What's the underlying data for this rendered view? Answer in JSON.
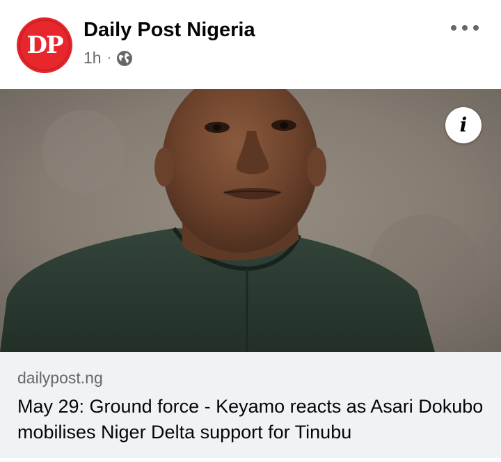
{
  "post": {
    "page_name": "Daily Post Nigeria",
    "avatar_text": "DP",
    "time": "1h",
    "separator": "·",
    "audience_icon": "globe-icon",
    "more_icon": "more-horizontal-icon",
    "info_icon": "info-icon",
    "info_glyph": "i",
    "link": {
      "domain": "dailypost.ng",
      "headline": "May 29: Ground force - Keyamo reacts as Asari Dokubo mobilises Niger Delta support for Tinubu"
    }
  },
  "colors": {
    "brand_red": "#e5262c",
    "name_text": "#050505",
    "secondary_text": "#65676b",
    "link_background": "#f0f2f5",
    "photo_background": "#857d74",
    "attire_green": "#2c3b2f"
  }
}
